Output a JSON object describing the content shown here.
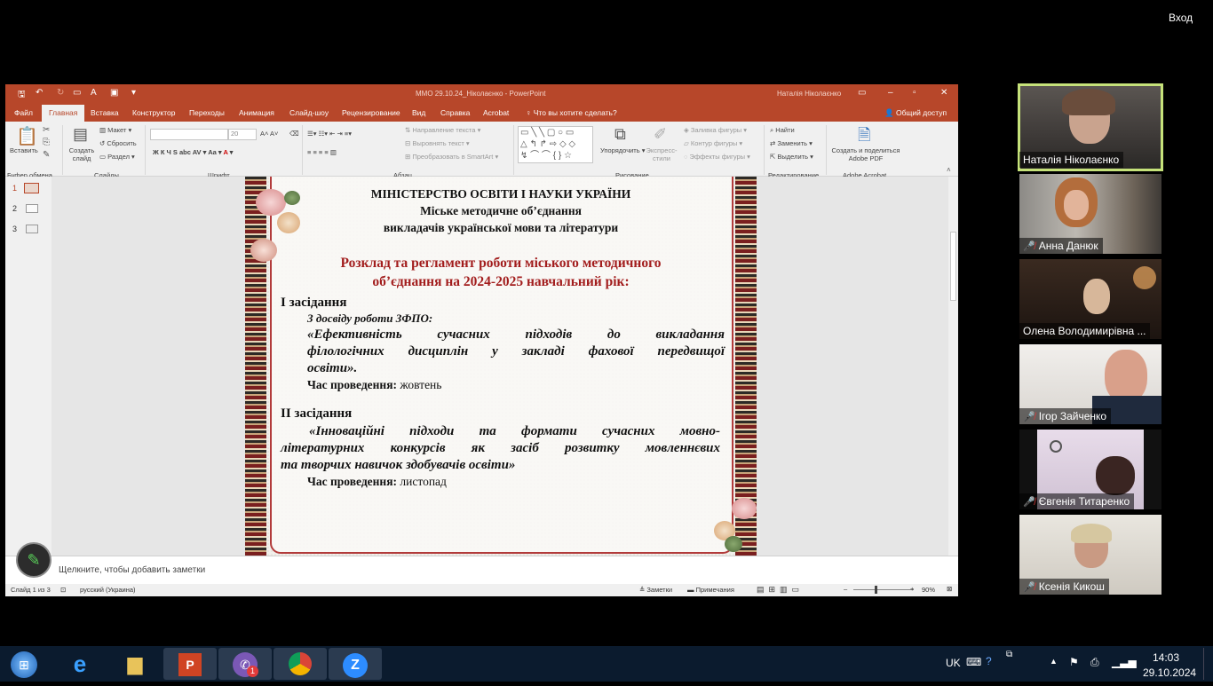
{
  "top": {
    "login_label": "Вход"
  },
  "ppt": {
    "title": "ММО 29.10.24_Ніколаєнко  -  PowerPoint",
    "user": "Наталія Ніколаєнко",
    "tabs": [
      "Файл",
      "Главная",
      "Вставка",
      "Конструктор",
      "Переходы",
      "Анимация",
      "Слайд-шоу",
      "Рецензирование",
      "Вид",
      "Справка",
      "Acrobat"
    ],
    "tellme": "Что вы хотите сделать?",
    "share": "Общий доступ",
    "ribbon": {
      "paste": "Вставить",
      "create_slide": "Создать\nслайд",
      "layout": "Макет",
      "reset": "Сбросить",
      "section": "Раздел",
      "font_size": "20",
      "text_direction": "Направление текста",
      "align_text": "Выровнять текст",
      "smartart": "Преобразовать в SmartArt",
      "arrange": "Упорядочить",
      "quick_styles": "Экспресс-стили",
      "fill": "Заливка фигуры",
      "outline": "Контур фигуры",
      "effects": "Эффекты фигуры",
      "find": "Найти",
      "replace": "Заменить",
      "select": "Выделить",
      "adobe": "Создать и поделиться Adobe PDF",
      "groups": {
        "clipboard": "Буфер обмена",
        "slides": "Слайды",
        "font": "Шрифт",
        "paragraph": "Абзац",
        "drawing": "Рисование",
        "editing": "Редактирование",
        "acrobat": "Adobe Acrobat"
      }
    },
    "thumb_numbers": [
      "1",
      "2",
      "3"
    ],
    "notes_placeholder": "Щелкните, чтобы добавить заметки",
    "status": {
      "slide": "Слайд 1 из 3",
      "lang": "русский (Украина)",
      "notes": "Заметки",
      "comments": "Примечания",
      "zoom": "90%"
    }
  },
  "slide": {
    "ministry": "МІНІСТЕРСТВО ОСВІТИ І НАУКИ УКРАЇНИ",
    "union": "Міське методичне об’єднання",
    "teachers": "викладачів української мови та літератури",
    "schedule_1": "Розклад та регламент роботи міського методичного",
    "schedule_2": "об’єднання на 2024-2025 навчальний рік:",
    "m1_title": "І засідання",
    "m1_sub": "З досвіду роботи ЗФПО:",
    "m1_line1": "«Ефективність сучасних підходів до викладання",
    "m1_line2": "філологічних дисциплін у закладі фахової передвищої",
    "m1_line3": "освіти».",
    "m1_time_label": "Час проведення:",
    "m1_time": " жовтень",
    "m2_title": "ІІ засідання",
    "m2_line1": "«Інноваційні підходи та формати сучасних мовно-",
    "m2_line2": "літературних конкурсів як засіб розвитку мовленнєвих",
    "m2_line3": "та творчих навичок здобувачів освіти»",
    "m2_time_label": "Час проведення:",
    "m2_time": " листопад"
  },
  "participants": [
    {
      "name": "Наталія Ніколаєнко",
      "muted": false
    },
    {
      "name": "Анна Данюк",
      "muted": true
    },
    {
      "name": "Олена Володимирівна ...",
      "muted": false
    },
    {
      "name": "Ігор Зайченко",
      "muted": true
    },
    {
      "name": "Євгенія Титаренко",
      "muted": true
    },
    {
      "name": "Ксенія Кикош",
      "muted": true
    }
  ],
  "taskbar": {
    "lang": "UK",
    "time": "14:03",
    "date": "29.10.2024",
    "viber_badge": "1"
  }
}
